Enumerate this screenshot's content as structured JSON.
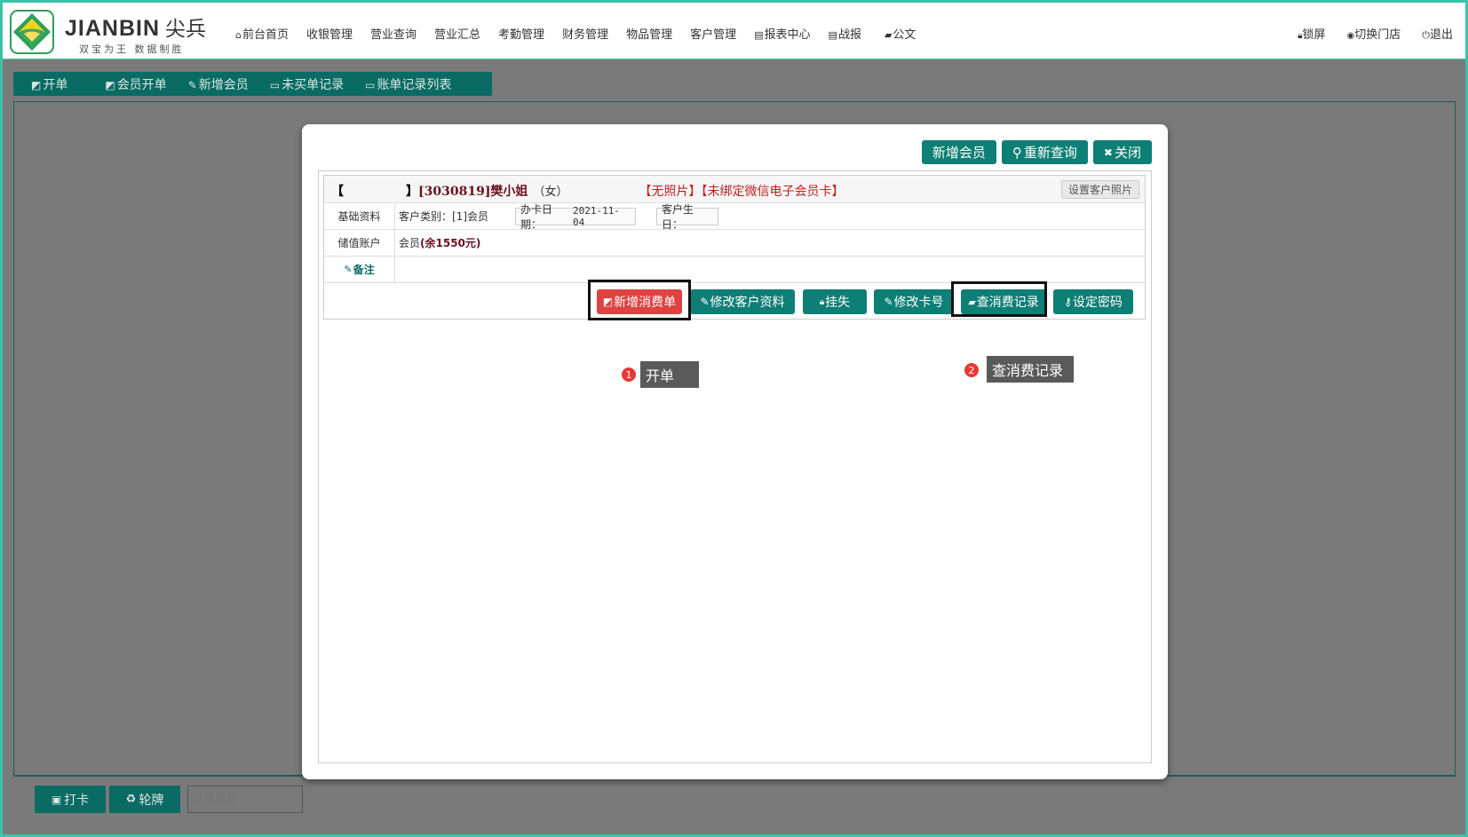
{
  "brand": {
    "name_en": "JIANBIN",
    "name_cn": "尖兵",
    "slogan": "双宝为王 数据制胜"
  },
  "nav": [
    {
      "icon": "home-icon",
      "glyph": "⌂",
      "label": "前台首页"
    },
    {
      "label": "收银管理"
    },
    {
      "label": "营业查询"
    },
    {
      "label": "营业汇总"
    },
    {
      "label": "考勤管理"
    },
    {
      "label": "财务管理"
    },
    {
      "label": "物品管理"
    },
    {
      "label": "客户管理"
    },
    {
      "icon": "table-icon",
      "glyph": "▤",
      "label": "报表中心"
    },
    {
      "icon": "report-icon",
      "glyph": "▤",
      "label": "战报"
    },
    {
      "icon": "book-icon",
      "glyph": "▰",
      "label": "公文"
    }
  ],
  "right_nav": [
    {
      "icon": "lock-icon",
      "glyph": "🔒︎",
      "label": "锁屏"
    },
    {
      "icon": "location-icon",
      "glyph": "◉",
      "label": "切换门店"
    },
    {
      "icon": "power-icon",
      "glyph": "⏻",
      "label": "退出"
    }
  ],
  "toolbar": [
    {
      "icon": "open-bill-icon",
      "glyph": "◩",
      "label": "开单"
    },
    {
      "icon": "member-bill-icon",
      "glyph": "◩",
      "label": "会员开单"
    },
    {
      "icon": "edit-icon",
      "glyph": "✎",
      "label": "新增会员"
    },
    {
      "icon": "monitor-icon",
      "glyph": "▭",
      "label": "未买单记录"
    },
    {
      "icon": "monitor-icon",
      "glyph": "▭",
      "label": "账单记录列表"
    }
  ],
  "bottom": {
    "punch_label": "打卡",
    "rotate_label": "轮牌",
    "filter_placeholder": "过滤账单"
  },
  "modal": {
    "top_buttons": [
      {
        "name": "add-member-button",
        "label": "新增会员"
      },
      {
        "name": "requery-button",
        "glyph": "⚲",
        "label": "重新查询"
      },
      {
        "name": "close-button",
        "glyph": "✖",
        "label": "关闭"
      }
    ],
    "customer": {
      "bracket_open": "【",
      "bracket_close": "】",
      "id_name": "[3030819]樊小姐",
      "gender": "（女）",
      "no_photo": "【无照片】",
      "no_wechat": "【未绑定微信电子会员卡】",
      "set_photo": "设置客户照片"
    },
    "basic": {
      "label": "基础资料",
      "type": "客户类别：[1]会员",
      "card_date_label": "办卡日期：",
      "card_date": "2021-11-04",
      "birthday": "客户生日："
    },
    "account": {
      "label": "储值账户",
      "prefix": "会员",
      "balance": "(余1550元)"
    },
    "note": {
      "glyph": "✎",
      "label": "备注"
    },
    "actions": [
      {
        "name": "new-consume-button",
        "glyph": "◩",
        "label": "新增消费单",
        "color": "#e04141"
      },
      {
        "name": "edit-profile-button",
        "glyph": "✎",
        "label": "修改客户资料"
      },
      {
        "name": "report-loss-button",
        "glyph": "🔒︎",
        "label": "挂失"
      },
      {
        "name": "edit-card-button",
        "glyph": "✎",
        "label": "修改卡号"
      },
      {
        "name": "consume-records-button",
        "glyph": "▰",
        "label": "查消费记录"
      },
      {
        "name": "set-password-button",
        "glyph": "⚷",
        "label": "设定密码"
      }
    ],
    "annotations": [
      {
        "num": "1",
        "text": "开单"
      },
      {
        "num": "2",
        "text": "查消费记录"
      }
    ]
  }
}
